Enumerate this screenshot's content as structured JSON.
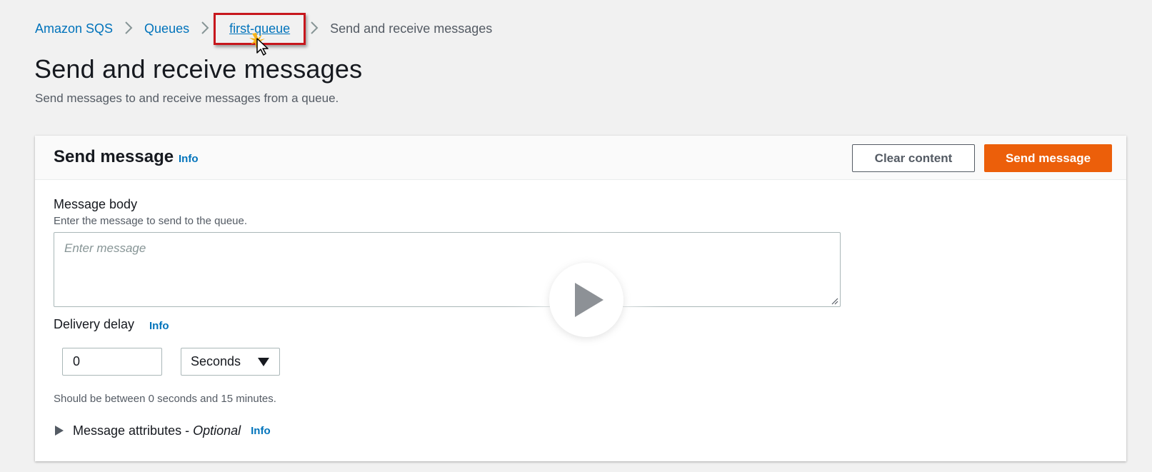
{
  "breadcrumb": {
    "items": [
      "Amazon SQS",
      "Queues",
      "first-queue"
    ],
    "current": "Send and receive messages"
  },
  "page": {
    "title": "Send and receive messages",
    "description": "Send messages to and receive messages from a queue."
  },
  "send_panel": {
    "title": "Send message",
    "info": "Info",
    "clear_button": "Clear content",
    "send_button": "Send message"
  },
  "message_body": {
    "label": "Message body",
    "description": "Enter the message to send to the queue.",
    "placeholder": "Enter message"
  },
  "delivery_delay": {
    "label": "Delivery delay",
    "info": "Info",
    "value": "0",
    "unit": "Seconds",
    "hint": "Should be between 0 seconds and 15 minutes."
  },
  "message_attributes": {
    "label": "Message attributes -",
    "optional": "Optional",
    "info": "Info"
  },
  "colors": {
    "link": "#0073bb",
    "primary_button": "#ec5f0a",
    "highlight_border": "#c7171d"
  },
  "icons": [
    "chevron-right-icon",
    "caret-down-icon",
    "caret-right-icon",
    "play-icon",
    "mouse-pointer-icon"
  ]
}
